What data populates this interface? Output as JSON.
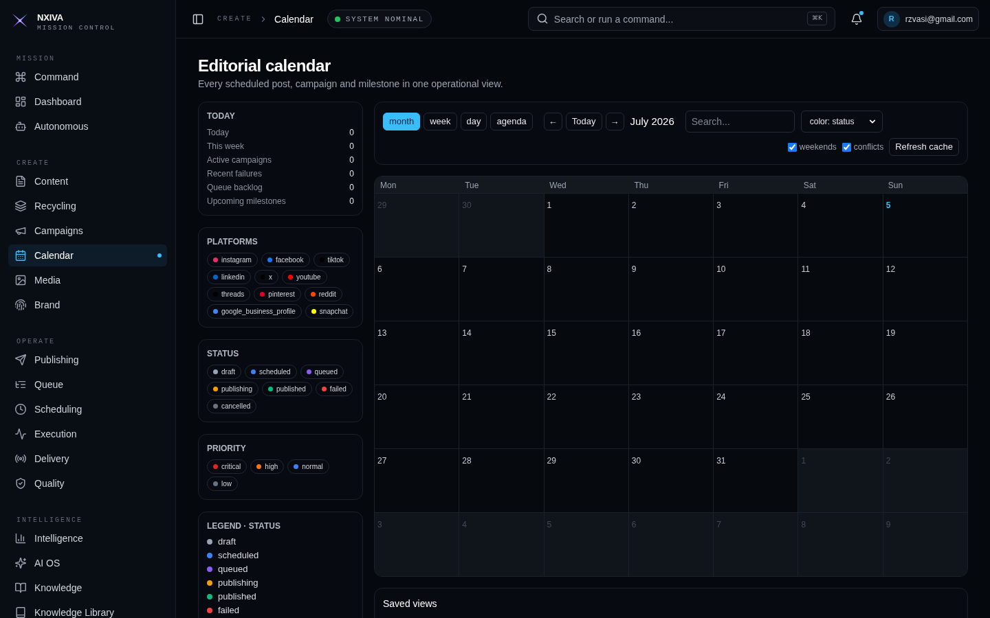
{
  "brand": {
    "name": "NXIVA",
    "tagline": "MISSION CONTROL"
  },
  "sidebar": {
    "sections": [
      {
        "label": "MISSION",
        "items": [
          {
            "label": "Command",
            "selected": false
          },
          {
            "label": "Dashboard",
            "selected": false
          },
          {
            "label": "Autonomous",
            "selected": false
          }
        ]
      },
      {
        "label": "CREATE",
        "items": [
          {
            "label": "Content",
            "selected": false
          },
          {
            "label": "Recycling",
            "selected": false
          },
          {
            "label": "Campaigns",
            "selected": false
          },
          {
            "label": "Calendar",
            "selected": true
          },
          {
            "label": "Media",
            "selected": false
          },
          {
            "label": "Brand",
            "selected": false
          }
        ]
      },
      {
        "label": "OPERATE",
        "items": [
          {
            "label": "Publishing",
            "selected": false
          },
          {
            "label": "Queue",
            "selected": false
          },
          {
            "label": "Scheduling",
            "selected": false
          },
          {
            "label": "Execution",
            "selected": false
          },
          {
            "label": "Delivery",
            "selected": false
          },
          {
            "label": "Quality",
            "selected": false
          }
        ]
      },
      {
        "label": "INTELLIGENCE",
        "items": [
          {
            "label": "Intelligence",
            "selected": false
          },
          {
            "label": "AI OS",
            "selected": false
          },
          {
            "label": "Knowledge",
            "selected": false
          },
          {
            "label": "Knowledge Library",
            "selected": false
          }
        ]
      }
    ]
  },
  "topbar": {
    "breadcrumb": [
      "CREATE",
      "Calendar"
    ],
    "system_status": "SYSTEM NOMINAL",
    "search": {
      "placeholder": "Search or run a command...",
      "shortcut": "⌘K"
    },
    "notifications": {
      "unread": true
    },
    "user": {
      "initial": "R",
      "email": "rzvasi@gmail.com"
    }
  },
  "page": {
    "title": "Editorial calendar",
    "subtitle": "Every scheduled post, campaign and milestone in one operational view."
  },
  "today_panel": {
    "title": "TODAY",
    "rows": [
      {
        "label": "Today",
        "value": "0"
      },
      {
        "label": "This week",
        "value": "0"
      },
      {
        "label": "Active campaigns",
        "value": "0"
      },
      {
        "label": "Recent failures",
        "value": "0"
      },
      {
        "label": "Queue backlog",
        "value": "0"
      },
      {
        "label": "Upcoming milestones",
        "value": "0"
      }
    ]
  },
  "platforms": {
    "title": "PLATFORMS",
    "chips": [
      {
        "label": "instagram",
        "color": "#e1306c"
      },
      {
        "label": "facebook",
        "color": "#1877f2"
      },
      {
        "label": "tiktok",
        "color": "#000000"
      },
      {
        "label": "linkedin",
        "color": "#0a66c2"
      },
      {
        "label": "x",
        "color": "#000000"
      },
      {
        "label": "youtube",
        "color": "#ff0000"
      },
      {
        "label": "threads",
        "color": "#000000"
      },
      {
        "label": "pinterest",
        "color": "#e60023"
      },
      {
        "label": "reddit",
        "color": "#ff4500"
      },
      {
        "label": "google_business_profile",
        "color": "#4285f4"
      },
      {
        "label": "snapchat",
        "color": "#fffc00"
      }
    ]
  },
  "status": {
    "title": "STATUS",
    "chips": [
      {
        "label": "draft",
        "color": "#94a3b8"
      },
      {
        "label": "scheduled",
        "color": "#3b82f6"
      },
      {
        "label": "queued",
        "color": "#8b5cf6"
      },
      {
        "label": "publishing",
        "color": "#f59e0b"
      },
      {
        "label": "published",
        "color": "#10b981"
      },
      {
        "label": "failed",
        "color": "#ef4444"
      },
      {
        "label": "cancelled",
        "color": "#6b7280"
      }
    ]
  },
  "priority": {
    "title": "PRIORITY",
    "chips": [
      {
        "label": "critical",
        "color": "#dc2626"
      },
      {
        "label": "high",
        "color": "#f97316"
      },
      {
        "label": "normal",
        "color": "#3b82f6"
      },
      {
        "label": "low",
        "color": "#64748b"
      }
    ]
  },
  "legend": {
    "title": "LEGEND · STATUS",
    "items": [
      {
        "label": "draft",
        "color": "#94a3b8"
      },
      {
        "label": "scheduled",
        "color": "#3b82f6"
      },
      {
        "label": "queued",
        "color": "#8b5cf6"
      },
      {
        "label": "publishing",
        "color": "#f59e0b"
      },
      {
        "label": "published",
        "color": "#10b981"
      },
      {
        "label": "failed",
        "color": "#ef4444"
      }
    ]
  },
  "toolbar": {
    "views": [
      {
        "label": "month",
        "selected": true
      },
      {
        "label": "week",
        "selected": false
      },
      {
        "label": "day",
        "selected": false
      },
      {
        "label": "agenda",
        "selected": false
      }
    ],
    "prev": "←",
    "today": "Today",
    "next": "→",
    "period": "July 2026",
    "search_placeholder": "Search...",
    "color_select": "color: status",
    "toggles": [
      {
        "label": "weekends",
        "checked": true
      },
      {
        "label": "conflicts",
        "checked": true
      }
    ],
    "refresh": "Refresh cache"
  },
  "calendar": {
    "weekdays": [
      "Mon",
      "Tue",
      "Wed",
      "Thu",
      "Fri",
      "Sat",
      "Sun"
    ],
    "weeks": [
      [
        {
          "day": "29",
          "in_month": false,
          "today": false
        },
        {
          "day": "30",
          "in_month": false,
          "today": false
        },
        {
          "day": "1",
          "in_month": true,
          "today": false
        },
        {
          "day": "2",
          "in_month": true,
          "today": false
        },
        {
          "day": "3",
          "in_month": true,
          "today": false
        },
        {
          "day": "4",
          "in_month": true,
          "today": false
        },
        {
          "day": "5",
          "in_month": true,
          "today": true
        }
      ],
      [
        {
          "day": "6",
          "in_month": true,
          "today": false
        },
        {
          "day": "7",
          "in_month": true,
          "today": false
        },
        {
          "day": "8",
          "in_month": true,
          "today": false
        },
        {
          "day": "9",
          "in_month": true,
          "today": false
        },
        {
          "day": "10",
          "in_month": true,
          "today": false
        },
        {
          "day": "11",
          "in_month": true,
          "today": false
        },
        {
          "day": "12",
          "in_month": true,
          "today": false
        }
      ],
      [
        {
          "day": "13",
          "in_month": true,
          "today": false
        },
        {
          "day": "14",
          "in_month": true,
          "today": false
        },
        {
          "day": "15",
          "in_month": true,
          "today": false
        },
        {
          "day": "16",
          "in_month": true,
          "today": false
        },
        {
          "day": "17",
          "in_month": true,
          "today": false
        },
        {
          "day": "18",
          "in_month": true,
          "today": false
        },
        {
          "day": "19",
          "in_month": true,
          "today": false
        }
      ],
      [
        {
          "day": "20",
          "in_month": true,
          "today": false
        },
        {
          "day": "21",
          "in_month": true,
          "today": false
        },
        {
          "day": "22",
          "in_month": true,
          "today": false
        },
        {
          "day": "23",
          "in_month": true,
          "today": false
        },
        {
          "day": "24",
          "in_month": true,
          "today": false
        },
        {
          "day": "25",
          "in_month": true,
          "today": false
        },
        {
          "day": "26",
          "in_month": true,
          "today": false
        }
      ],
      [
        {
          "day": "27",
          "in_month": true,
          "today": false
        },
        {
          "day": "28",
          "in_month": true,
          "today": false
        },
        {
          "day": "29",
          "in_month": true,
          "today": false
        },
        {
          "day": "30",
          "in_month": true,
          "today": false
        },
        {
          "day": "31",
          "in_month": true,
          "today": false
        },
        {
          "day": "1",
          "in_month": false,
          "today": false
        },
        {
          "day": "2",
          "in_month": false,
          "today": false
        }
      ],
      [
        {
          "day": "3",
          "in_month": false,
          "today": false
        },
        {
          "day": "4",
          "in_month": false,
          "today": false
        },
        {
          "day": "5",
          "in_month": false,
          "today": false
        },
        {
          "day": "6",
          "in_month": false,
          "today": false
        },
        {
          "day": "7",
          "in_month": false,
          "today": false
        },
        {
          "day": "8",
          "in_month": false,
          "today": false
        },
        {
          "day": "9",
          "in_month": false,
          "today": false
        }
      ]
    ]
  },
  "saved_views": {
    "title": "Saved views"
  }
}
